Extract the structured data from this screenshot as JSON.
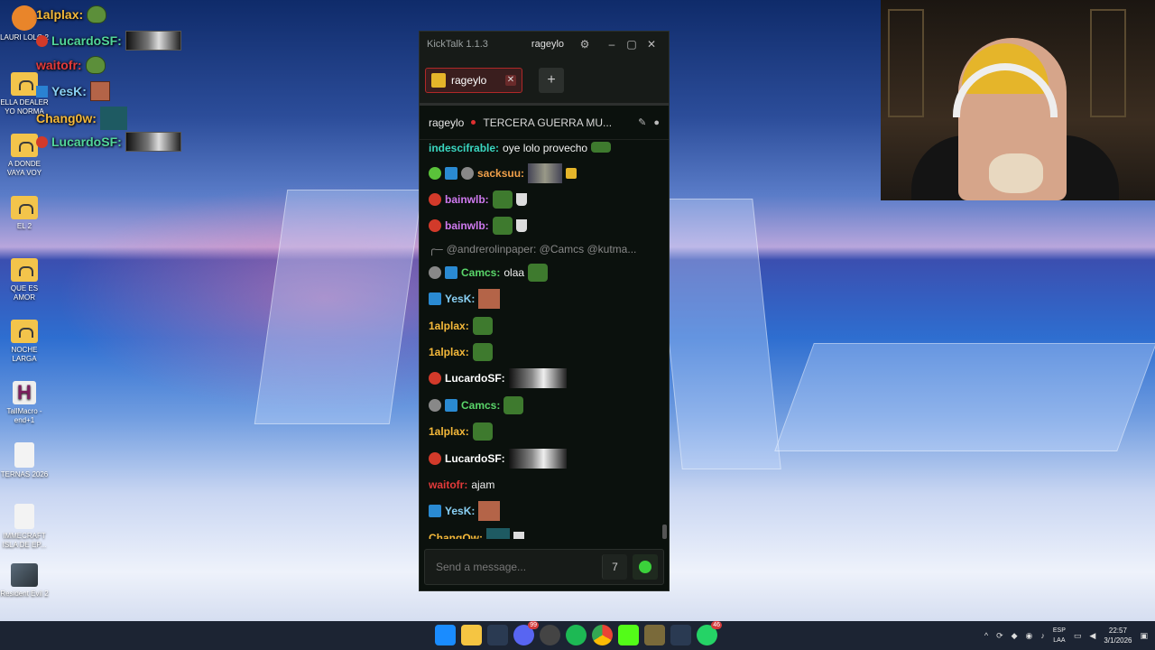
{
  "desktop": {
    "icons": [
      {
        "label": "LAURI LOLO 2"
      },
      {
        "label": "ELLA DEALER YO NORMA"
      },
      {
        "label": "A DONDE VAYA VOY"
      },
      {
        "label": "EL 2"
      },
      {
        "label": "QUE ES AMOR"
      },
      {
        "label": "NOCHE LARGA"
      },
      {
        "label": "TallMacro - end+1"
      },
      {
        "label": "TERNAS 2026"
      },
      {
        "label": "IMMECRAFT ISLA DE EP..."
      },
      {
        "label": "Resident Evil 2"
      }
    ],
    "overlay_chat": [
      {
        "name": "1alplax:",
        "color": "#f5b93a"
      },
      {
        "name": "LucardoSF:",
        "color": "#52d69a"
      },
      {
        "name": "waitofr:",
        "color": "#e33a3a"
      },
      {
        "name": "YesK:",
        "color": "#8ad1f5"
      },
      {
        "name": "Chang0w:",
        "color": "#f5b93a"
      },
      {
        "name": "LucardoSF:",
        "color": "#52d69a"
      }
    ]
  },
  "kicktalk": {
    "app_title": "KickTalk 1.1.3",
    "current_user": "rageylo",
    "tab_label": "rageylo",
    "add_tab": "+",
    "stream_name": "rageylo",
    "stream_title": "TERCERA GUERRA MU...",
    "messages": [
      {
        "name": "indescifrable:",
        "color": "#3ad6c0",
        "text": "oye lolo provecho"
      },
      {
        "name": "sacksuu:",
        "color": "#f0a04a",
        "text": ""
      },
      {
        "name": "bainwlb:",
        "color": "#d07af0",
        "text": ""
      },
      {
        "name": "bainwlb:",
        "color": "#d07af0",
        "text": ""
      },
      {
        "name": "",
        "color": "#888888",
        "text": "@andrerolinpaper: @Camcs @kutma..."
      },
      {
        "name": "Camcs:",
        "color": "#5ad66a",
        "text": "olaa"
      },
      {
        "name": "YesK:",
        "color": "#8ad1f5",
        "text": ""
      },
      {
        "name": "1alplax:",
        "color": "#f5b93a",
        "text": ""
      },
      {
        "name": "1alplax:",
        "color": "#f5b93a",
        "text": ""
      },
      {
        "name": "LucardoSF:",
        "color": "#ffffff",
        "text": ""
      },
      {
        "name": "Camcs:",
        "color": "#5ad66a",
        "text": ""
      },
      {
        "name": "1alplax:",
        "color": "#f5b93a",
        "text": ""
      },
      {
        "name": "LucardoSF:",
        "color": "#ffffff",
        "text": ""
      },
      {
        "name": "waitofr:",
        "color": "#e33a3a",
        "text": "ajam"
      },
      {
        "name": "YesK:",
        "color": "#8ad1f5",
        "text": ""
      },
      {
        "name": "ChangOw:",
        "color": "#f5b93a",
        "text": ""
      }
    ],
    "input_placeholder": "Send a message..."
  },
  "taskbar": {
    "discord_badge": "99",
    "whatsapp_badge": "46",
    "lang_top": "ESP",
    "lang_bottom": "LAA",
    "time": "22:57",
    "date": "3/1/2026"
  }
}
